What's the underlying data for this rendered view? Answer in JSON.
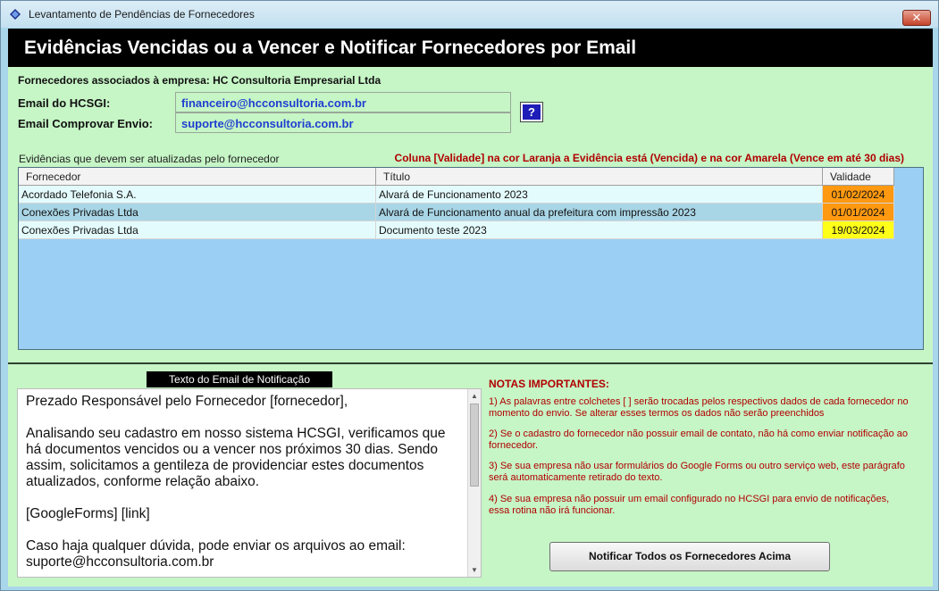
{
  "window": {
    "title": "Levantamento de Pendências de Fornecedores",
    "close_label": "✕"
  },
  "header": {
    "title": "Evidências Vencidas ou a Vencer e Notificar Fornecedores por Email"
  },
  "company": {
    "label": "Fornecedores associados à empresa: HC Consultoria Empresarial Ltda"
  },
  "emails": {
    "hcsgi_label": "Email do HCSGI:",
    "hcsgi_value": "financeiro@hcconsultoria.com.br",
    "proof_label": "Email Comprovar Envio:",
    "proof_value": "suporte@hcconsultoria.com.br",
    "help_label": "?"
  },
  "grid": {
    "caption": "Evidências que devem ser atualizadas pelo fornecedor",
    "note": "Coluna [Validade] na cor Laranja a Evidência está (Vencida) e na cor Amarela (Vence em até 30 dias)",
    "columns": [
      "Fornecedor",
      "Título",
      "Validade"
    ],
    "rows": [
      {
        "fornecedor": "Acordado Telefonia S.A.",
        "titulo": "Alvará de Funcionamento 2023",
        "validade": "01/02/2024",
        "status": "vencida"
      },
      {
        "fornecedor": "Conexões Privadas Ltda",
        "titulo": "Alvará de Funcionamento anual da prefeitura com impressão 2023",
        "validade": "01/01/2024",
        "status": "vencida"
      },
      {
        "fornecedor": "Conexões Privadas Ltda",
        "titulo": "Documento teste 2023",
        "validade": "19/03/2024",
        "status": "a_vencer"
      }
    ]
  },
  "colors": {
    "row_light": "#e4fbfd",
    "row_dark": "#a9d6e6",
    "selected_row": "#a9d6e6",
    "vencida": "#ff9911",
    "a_vencer": "#ffff1a",
    "notes": "#b10000"
  },
  "email_text": {
    "label": "Texto do Email de Notificação",
    "body": "Prezado Responsável pelo Fornecedor [fornecedor],\n\nAnalisando seu cadastro em nosso sistema HCSGI, verificamos que há documentos vencidos ou a vencer nos próximos 30 dias. Sendo assim, solicitamos a gentileza de providenciar estes documentos atualizados, conforme relação abaixo.\n\n[GoogleForms] [link]\n\nCaso haja qualquer dúvida, pode enviar os arquivos ao email:\nsuporte@hcconsultoria.com.br"
  },
  "notes": {
    "title": "NOTAS IMPORTANTES:",
    "items": [
      "1) As palavras entre colchetes [ ] serão trocadas pelos respectivos dados de cada fornecedor no momento do envio. Se alterar esses termos os dados não serão preenchidos",
      "2) Se o cadastro do fornecedor não possuir email de contato, não há como enviar notificação ao fornecedor.",
      "3) Se sua empresa não usar formulários do Google Forms ou outro serviço web, este parágrafo será automaticamente retirado do texto.",
      "4) Se sua empresa não possuir um email configurado no HCSGI para envio de notificações, essa rotina não irá funcionar."
    ]
  },
  "actions": {
    "notify_all": "Notificar Todos os Fornecedores Acima"
  }
}
